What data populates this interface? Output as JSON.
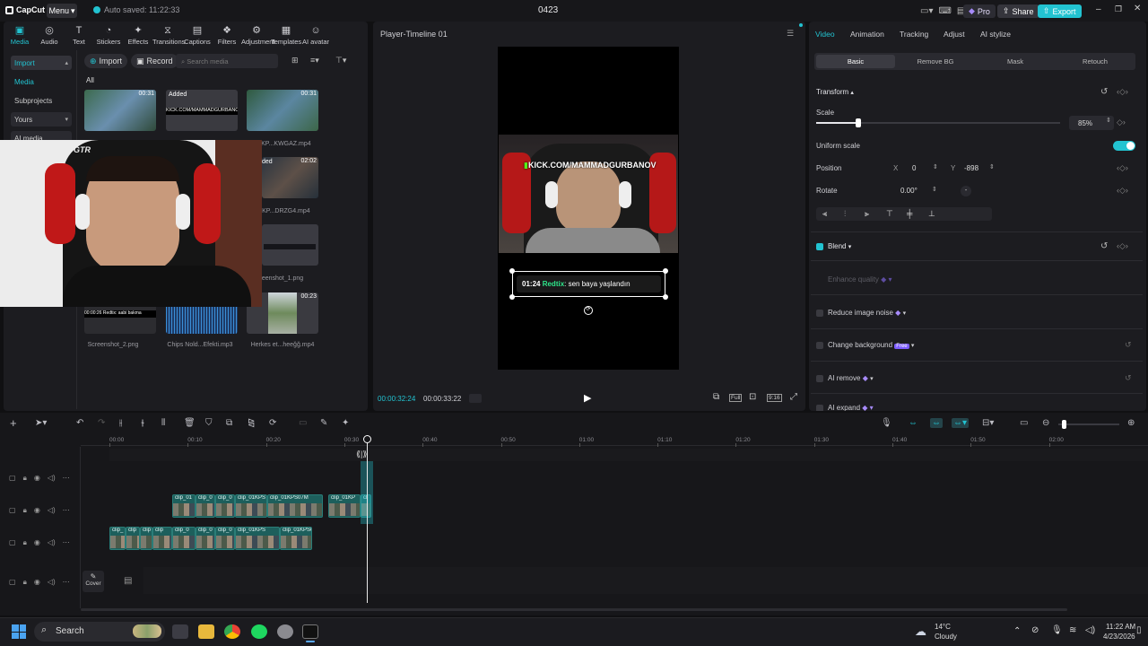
{
  "titlebar": {
    "app_name": "CapCut",
    "menu_label": "Menu",
    "autosave": "Auto saved: 11:22:33",
    "project_title": "0423",
    "pro_label": "Pro",
    "share_label": "Share",
    "export_label": "Export"
  },
  "toolbar": {
    "tabs": [
      {
        "label": "Media",
        "icon": "media-icon"
      },
      {
        "label": "Audio",
        "icon": "audio-icon"
      },
      {
        "label": "Text",
        "icon": "text-icon"
      },
      {
        "label": "Stickers",
        "icon": "stickers-icon"
      },
      {
        "label": "Effects",
        "icon": "effects-icon"
      },
      {
        "label": "Transitions",
        "icon": "transitions-icon"
      },
      {
        "label": "Captions",
        "icon": "captions-icon"
      },
      {
        "label": "Filters",
        "icon": "filters-icon"
      },
      {
        "label": "Adjustment",
        "icon": "adjustment-icon"
      },
      {
        "label": "Templates",
        "icon": "templates-icon"
      },
      {
        "label": "AI avatar",
        "icon": "ai-avatar-icon"
      }
    ]
  },
  "sidebar": {
    "items": [
      "Import",
      "Media",
      "Subprojects",
      "Yours",
      "AI media"
    ]
  },
  "media": {
    "import_label": "Import",
    "record_label": "Record",
    "search_placeholder": "Search media",
    "filter_all": "All",
    "items": [
      {
        "name": "",
        "duration": "00:31",
        "badge": ""
      },
      {
        "name": "",
        "duration": "",
        "badge": "Added"
      },
      {
        "name": "",
        "duration": "00:31",
        "badge": ""
      },
      {
        "name": "01KP...KWGAZ.mp4",
        "duration": "",
        "badge": ""
      },
      {
        "name": "01KP...DRZG4.mp4",
        "duration": "02:02",
        "badge": "ded"
      },
      {
        "name": "eenshot_1.png",
        "duration": "",
        "badge": ""
      },
      {
        "name": "Screenshot_2.png",
        "duration": "",
        "badge": ""
      },
      {
        "name": "Chips Nold...Efekti.mp3",
        "duration": "",
        "badge": ""
      },
      {
        "name": "Herkes et...heeğğ.mp4",
        "duration": "00:23",
        "badge": ""
      }
    ],
    "added_strip_text": "KICK.COM/MAMMADGURBANOV",
    "screenshot_text": "00:00:26 Redtix: aabi bakma"
  },
  "player": {
    "title": "Player-Timeline 01",
    "current_time": "00:00:32:24",
    "total_time": "00:00:33:22",
    "overlay_text": "KICK.COM/MAMMADGURBANOV",
    "caption_time": "01:24",
    "caption_user": "Redtix",
    "caption_msg": ": sen baya yaşlandın",
    "full_label": "Full",
    "ratio_label": "9:16"
  },
  "right_panel": {
    "tabs": [
      "Video",
      "Animation",
      "Tracking",
      "Adjust",
      "AI stylize"
    ],
    "subtabs": [
      "Basic",
      "Remove BG",
      "Mask",
      "Retouch"
    ],
    "transform_label": "Transform",
    "scale_label": "Scale",
    "scale_value": "85%",
    "scale_fraction": 0.85,
    "uniform_scale_label": "Uniform scale",
    "position_label": "Position",
    "pos_x_label": "X",
    "pos_x": "0",
    "pos_y_label": "Y",
    "pos_y": "-898",
    "rotate_label": "Rotate",
    "rotate_value": "0.00°",
    "rotate_dash": "-",
    "blend_label": "Blend",
    "enhance_label": "Enhance quality",
    "noise_label": "Reduce image noise",
    "change_bg_label": "Change background",
    "free_badge": "Free",
    "ai_remove_label": "AI remove",
    "ai_expand_label": "AI expand"
  },
  "timeline": {
    "ruler": [
      "00:00",
      "00:10",
      "00:20",
      "00:30",
      "00:40",
      "00:50",
      "01:00",
      "01:10",
      "01:20",
      "01:30",
      "01:40",
      "01:50",
      "02:00"
    ],
    "cover_label": "Cover",
    "track2_clips": [
      "clip_01",
      "clip_0",
      "clip_0",
      "clip_01KPS",
      "clip_01KPS07M",
      "clip_01KP",
      "cl"
    ],
    "track3_clips": [
      "clip_",
      "clip",
      "clip",
      "clip",
      "clip_0",
      "clip_0",
      "clip_0",
      "clip_01KPS",
      "clip_01KPS07M"
    ]
  },
  "taskbar": {
    "search_label": "Search",
    "weather_temp": "14°C",
    "weather_desc": "Cloudy",
    "time": "11:22 AM",
    "date": "4/23/2026"
  },
  "colors": {
    "accent": "#22c3d1",
    "caption_green": "#2ee58a",
    "kick_green": "#53fc18"
  }
}
